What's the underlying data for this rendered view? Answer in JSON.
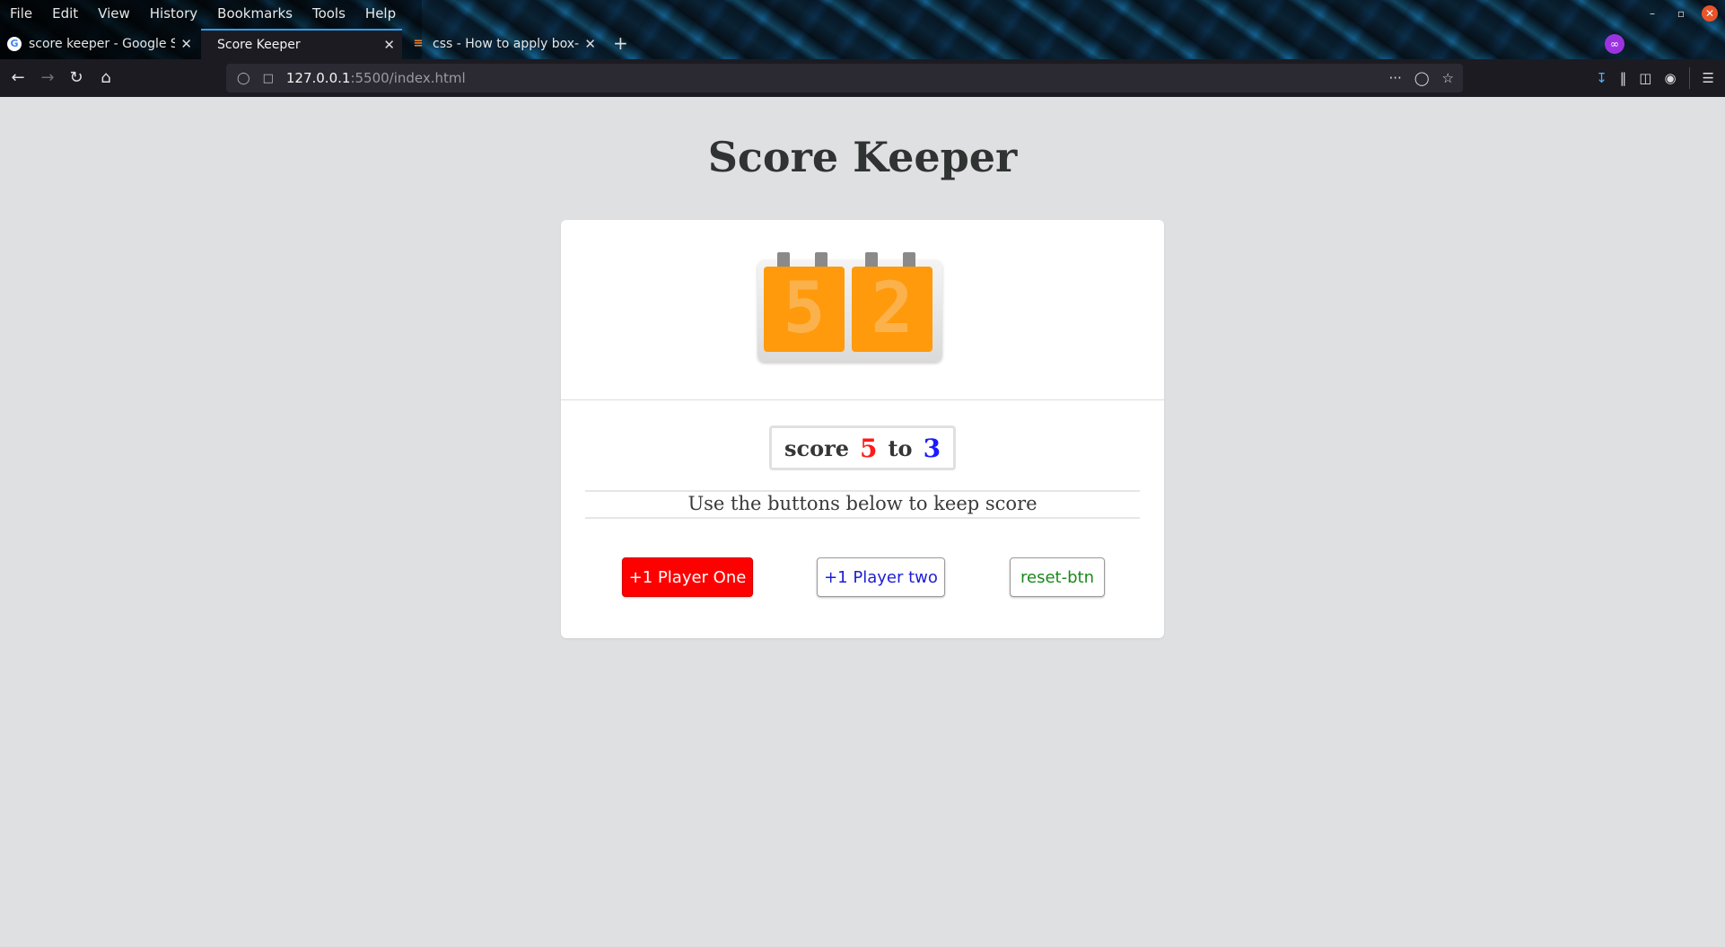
{
  "browser": {
    "menu": [
      "File",
      "Edit",
      "View",
      "History",
      "Bookmarks",
      "Tools",
      "Help"
    ],
    "tabs": [
      {
        "title": "score keeper - Google Se",
        "favicon": "google-icon",
        "active": false
      },
      {
        "title": "Score Keeper",
        "favicon": "",
        "active": true
      },
      {
        "title": "css - How to apply box-sh",
        "favicon": "stackoverflow-icon",
        "active": false
      }
    ],
    "url_host": "127.0.0.1",
    "url_rest": ":5500/index.html",
    "accent_color": "#2ba0f0"
  },
  "page": {
    "title": "Score Keeper",
    "image": {
      "left_digit": "5",
      "right_digit": "2",
      "tile_color": "#ff9a0c"
    },
    "score": {
      "label": "score",
      "player1": "5",
      "separator": "to",
      "player2": "3",
      "player1_color": "#ff1a1a",
      "player2_color": "#1a1aff"
    },
    "instructions": "Use the buttons below to keep score",
    "buttons": {
      "player1": "+1 Player One",
      "player2": "+1 Player two",
      "reset": "reset-btn"
    }
  }
}
